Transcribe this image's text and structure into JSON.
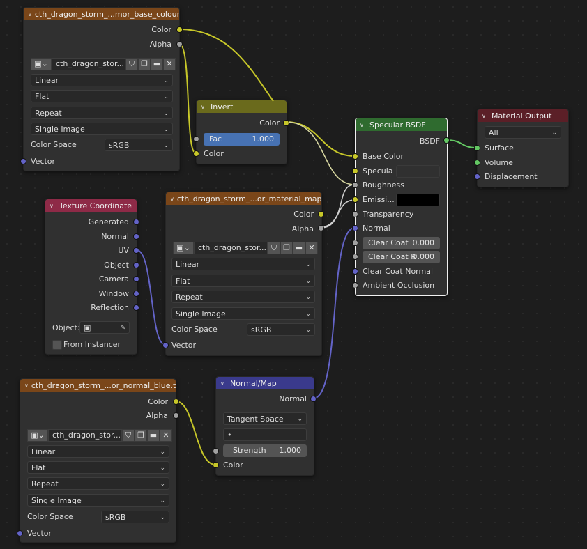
{
  "image_node_1": {
    "title": "cth_dragon_storm_...mor_base_colour.tga",
    "out_color": "Color",
    "out_alpha": "Alpha",
    "image_name": "cth_dragon_stor...",
    "interpolation": "Linear",
    "projection": "Flat",
    "extension": "Repeat",
    "source": "Single Image",
    "color_space_label": "Color Space",
    "color_space": "sRGB",
    "in_vector": "Vector"
  },
  "invert_node": {
    "title": "Invert",
    "out_color": "Color",
    "fac_label": "Fac",
    "fac_value": "1.000",
    "in_color": "Color"
  },
  "bsdf_node": {
    "title": "Specular BSDF",
    "out_bsdf": "BSDF",
    "base_color": "Base Color",
    "specular": "Specula",
    "roughness": "Roughness",
    "emission": "Emissi...",
    "transparency": "Transparency",
    "normal": "Normal",
    "clear_coat_label": "Clear Coat",
    "clear_coat_value": "0.000",
    "clear_coat_r_label": "Clear Coat R",
    "clear_coat_r_value": "0.000",
    "clear_coat_normal": "Clear Coat Normal",
    "ambient_occlusion": "Ambient Occlusion",
    "emission_color": "#000000",
    "specular_color": "#2b2b2b"
  },
  "output_node": {
    "title": "Material Output",
    "target": "All",
    "surface": "Surface",
    "volume": "Volume",
    "displacement": "Displacement"
  },
  "texcoord_node": {
    "title": "Texture Coordinate",
    "outputs": [
      "Generated",
      "Normal",
      "UV",
      "Object",
      "Camera",
      "Window",
      "Reflection"
    ],
    "object_label": "Object:",
    "from_instancer": "From Instancer"
  },
  "image_node_2": {
    "title": "cth_dragon_storm_...or_material_map.tga",
    "out_color": "Color",
    "out_alpha": "Alpha",
    "image_name": "cth_dragon_stor...",
    "interpolation": "Linear",
    "projection": "Flat",
    "extension": "Repeat",
    "source": "Single Image",
    "color_space_label": "Color Space",
    "color_space": "sRGB",
    "in_vector": "Vector"
  },
  "image_node_3": {
    "title": "cth_dragon_storm_...or_normal_blue.tga",
    "out_color": "Color",
    "out_alpha": "Alpha",
    "image_name": "cth_dragon_stor...",
    "interpolation": "Linear",
    "projection": "Flat",
    "extension": "Repeat",
    "source": "Single Image",
    "color_space_label": "Color Space",
    "color_space": "sRGB",
    "in_vector": "Vector"
  },
  "normalmap_node": {
    "title": "Normal/Map",
    "out_normal": "Normal",
    "space": "Tangent Space",
    "uv_map": "•",
    "strength_label": "Strength",
    "strength_value": "1.000",
    "in_color": "Color"
  },
  "colors": {
    "socket_color": "#c7c729",
    "socket_float": "#a1a1a1",
    "socket_vector": "#6363c7",
    "socket_shader": "#63c763",
    "wire_color": "#c7c729",
    "wire_float": "#cfcfcf",
    "wire_vector": "#6363c7",
    "wire_shader": "#63c763"
  }
}
